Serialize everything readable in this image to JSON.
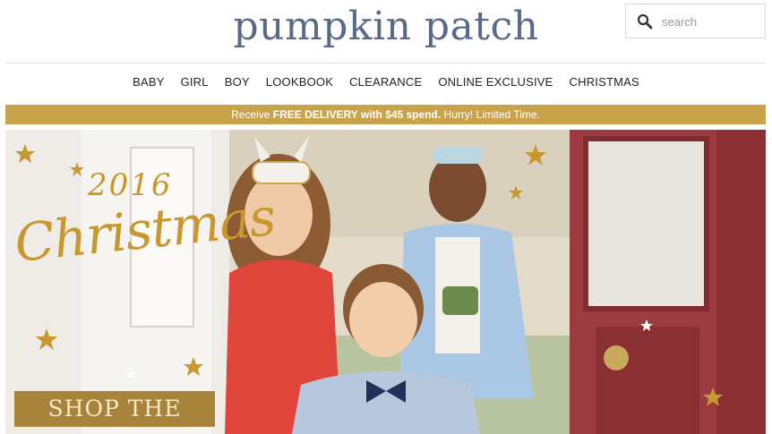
{
  "brand": {
    "logo_text": "pumpkin patch",
    "color": "#586a88"
  },
  "search": {
    "placeholder": "search",
    "icon": "search-icon"
  },
  "nav": {
    "items": [
      "BABY",
      "GIRL",
      "BOY",
      "LOOKBOOK",
      "CLEARANCE",
      "ONLINE EXCLUSIVE",
      "CHRISTMAS"
    ]
  },
  "promo": {
    "prefix": "Receive ",
    "highlight": "FREE DELIVERY with $45 spend.",
    "suffix": " Hurry! Limited Time.",
    "color": "#c9a24c"
  },
  "hero": {
    "year": "2016",
    "title": "Christmas",
    "cta_label": "SHOP THE LOOK",
    "accent_color": "#c8972d"
  }
}
